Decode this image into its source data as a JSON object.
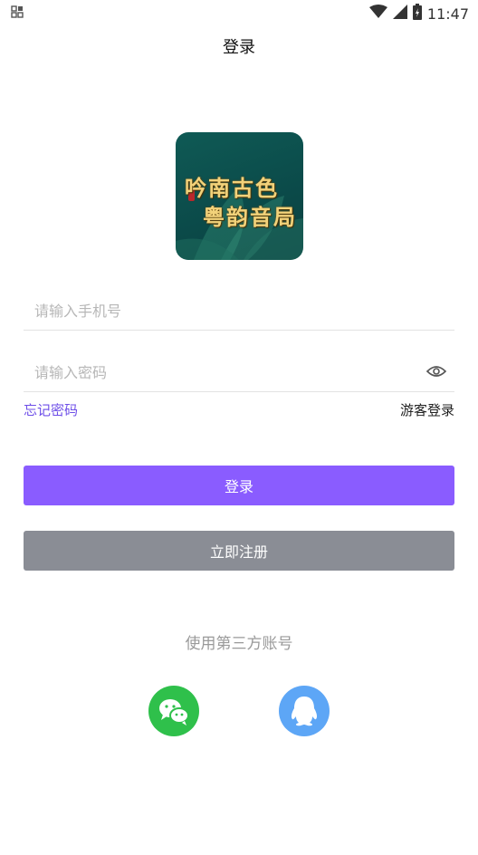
{
  "status_bar": {
    "left_icon": "notification-icon",
    "time": "11:47",
    "icons": [
      "wifi-icon",
      "signal-icon",
      "battery-icon"
    ]
  },
  "header": {
    "title": "登录"
  },
  "logo": {
    "line1": "吟南古色",
    "line2": "粤韵音局"
  },
  "form": {
    "phone_placeholder": "请输入手机号",
    "password_placeholder": "请输入密码"
  },
  "links": {
    "forgot": "忘记密码",
    "guest": "游客登录"
  },
  "buttons": {
    "login": "登录",
    "register": "立即注册"
  },
  "third_party": {
    "title": "使用第三方账号",
    "options": [
      "wechat-icon",
      "qq-icon"
    ]
  },
  "colors": {
    "primary": "#8a5cff",
    "secondary": "#8a8d95",
    "link": "#6e4fe8",
    "wechat": "#2fc04b",
    "qq": "#5da6f6"
  }
}
